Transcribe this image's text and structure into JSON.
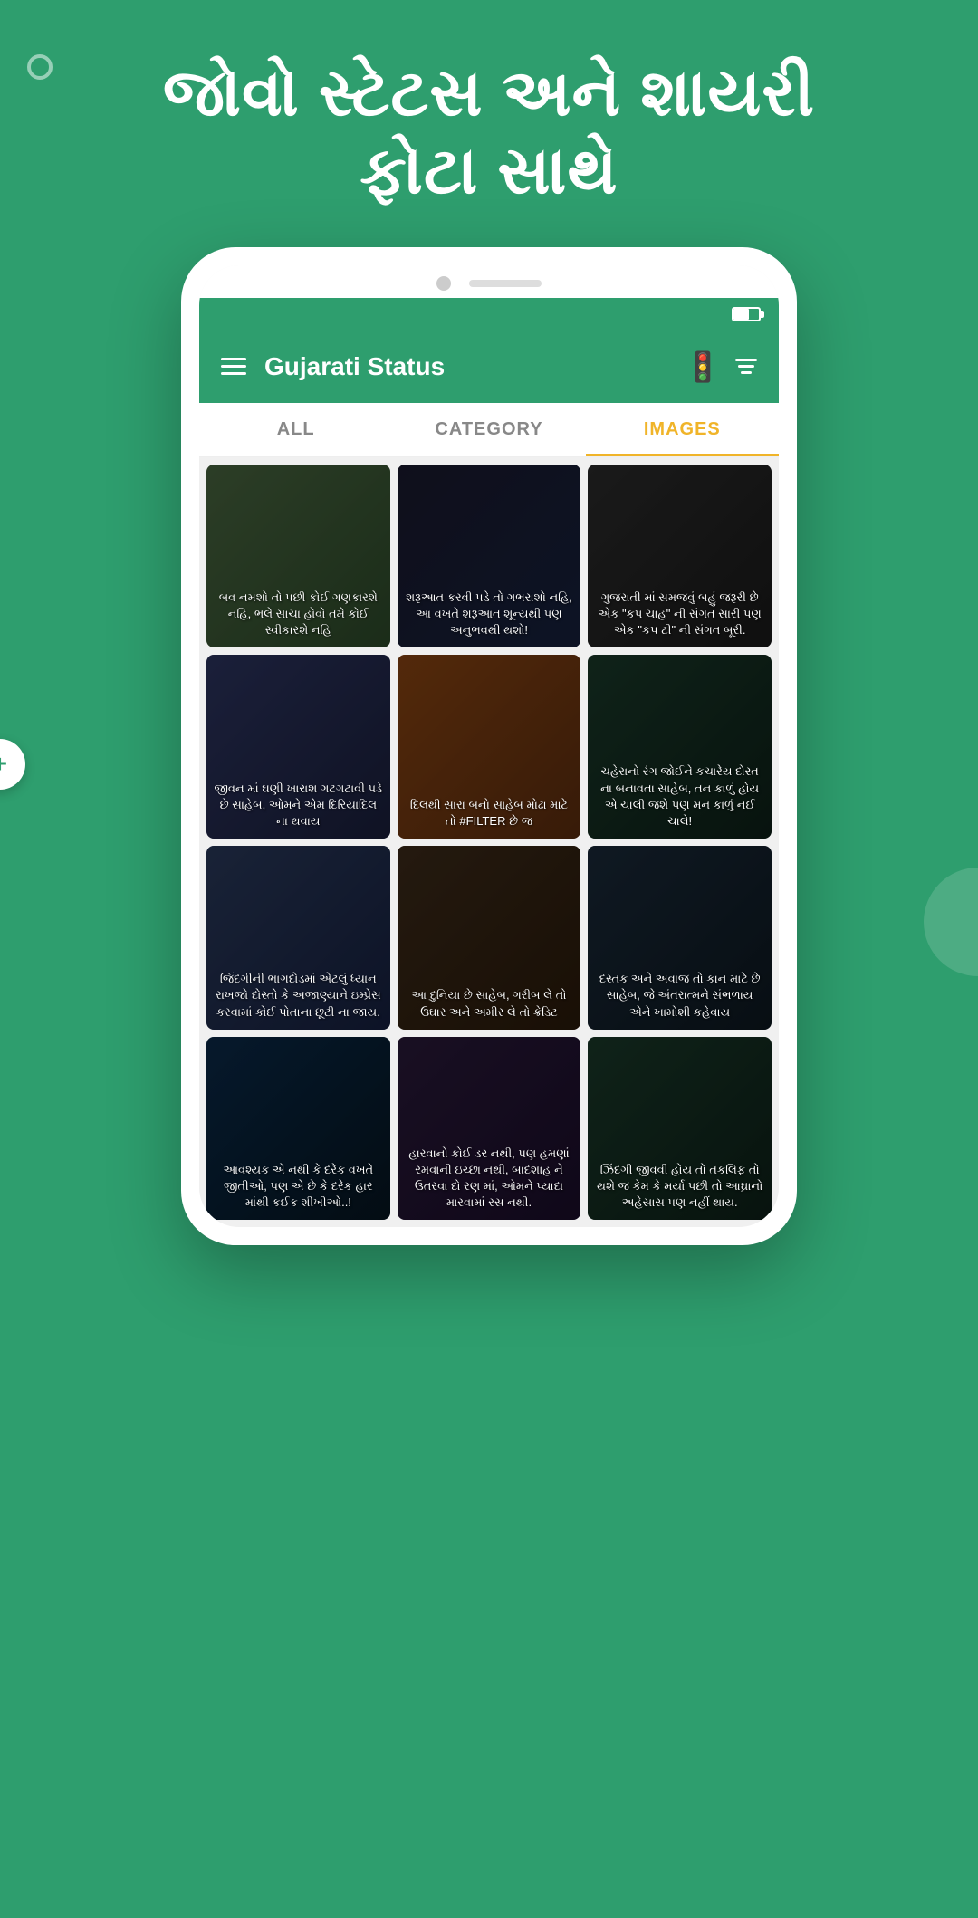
{
  "hero": {
    "title_line1": "જોવો સ્ટેટસ અને શાયરી",
    "title_line2": "ફોટા સાથે"
  },
  "appbar": {
    "title": "Gujarati Status",
    "robot_emoji": "🚦"
  },
  "tabs": [
    {
      "id": "all",
      "label": "ALL",
      "active": false
    },
    {
      "id": "category",
      "label": "CATEGORY",
      "active": false
    },
    {
      "id": "images",
      "label": "IMAGES",
      "active": true
    }
  ],
  "grid_items": [
    {
      "id": 1,
      "text": "બવ નમશો તો પછી કોઈ ગણકારશે નહિ, ભલે સાચા હોવો તમે કોઈ સ્વીકારશે નહિ",
      "color_class": "img-1"
    },
    {
      "id": 2,
      "text": "શરૂઆત કરવી પડે તો ગભરાશો નહિ, આ વખતે શરૂઆત શૂન્યથી પણ અનુભવથી થશો!",
      "color_class": "img-2"
    },
    {
      "id": 3,
      "text": "ગુજરાતી માં સમજવું બહું જરૂરી છે એક \"કપ ચાહ\" ની સંગત સારી પણ એક \"કપ ટી\" ની સંગત બૂરી.",
      "color_class": "img-3"
    },
    {
      "id": 4,
      "text": "જીવન માં ઘણી ખારાશ ગટગટાવી પડે છે સાહેબ, ઓમને એમ દિરિયાદિલ ના થવાય",
      "color_class": "img-4"
    },
    {
      "id": 5,
      "text": "દિલથી સારા બનો સાહેબ મોઢા માટે તો #FILTER છે જ",
      "color_class": "img-5"
    },
    {
      "id": 6,
      "text": "ચહેરાનો રંગ જોઈને કચારેય દોસ્ત ના બનાવતા સાહેબ, તન કાળું હોય એ ચાલી જશે પણ મન કાળું નઈ ચાલે!",
      "color_class": "img-6"
    },
    {
      "id": 7,
      "text": "જિંદગીની ભાગદોડમાં એટલું ધ્યાન રાખજો દોસ્તો કે અજાણ્યાને ઇમ્પ્રેસ કરવામાં કોઈ પોતાના છૂટી ના જાય.",
      "color_class": "img-7"
    },
    {
      "id": 8,
      "text": "આ દુનિયા છે સાહેબ, ગરીબ લે તો ઉઘાર અને અમીર લે તો ક્રેડિટ",
      "color_class": "img-8"
    },
    {
      "id": 9,
      "text": "દસ્તક અને અવાજ તો કાન માટે છે સાહેબ, જે અંતરાત્મને સંભળાય એને ખામોશી કહેવાય",
      "color_class": "img-9"
    },
    {
      "id": 10,
      "text": "આવશ્યક એ નથી કે દરેક વખતે જીતીઓ, પણ એ છે કે દરેક હાર માંથી કઈક શીખીઓ..!",
      "color_class": "img-10"
    },
    {
      "id": 11,
      "text": "હારવાનો કોઈ ડર નથી, પણ હમણાં રમવાની ઇચ્છા નથી, બાદશાહ ને ઉતરવા દો રણ માં, ઓમને પ્યાદા મારવામાં રસ નથી.",
      "color_class": "img-11"
    },
    {
      "id": 12,
      "text": "ઝિંદગી જીવવી હોય તો તકલિફ તો થશે જ કેમ કે મર્યા પછી તો આઘ્રાનો અહેસાસ પણ નહીં થાય.",
      "color_class": "img-12"
    }
  ],
  "fab": {
    "label": "+"
  }
}
